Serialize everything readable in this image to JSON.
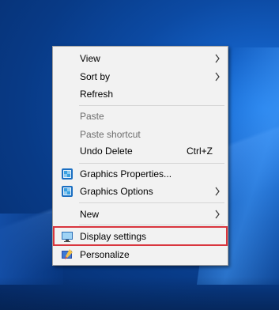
{
  "menu": {
    "items": [
      {
        "label": "View",
        "has_submenu": true,
        "enabled": true
      },
      {
        "label": "Sort by",
        "has_submenu": true,
        "enabled": true
      },
      {
        "label": "Refresh",
        "has_submenu": false,
        "enabled": true
      },
      {
        "label": "Paste",
        "has_submenu": false,
        "enabled": false
      },
      {
        "label": "Paste shortcut",
        "has_submenu": false,
        "enabled": false
      },
      {
        "label": "Undo Delete",
        "shortcut": "Ctrl+Z",
        "has_submenu": false,
        "enabled": true
      },
      {
        "label": "Graphics Properties...",
        "icon": "intel-graphics-icon",
        "has_submenu": false,
        "enabled": true
      },
      {
        "label": "Graphics Options",
        "icon": "intel-graphics-icon",
        "has_submenu": true,
        "enabled": true
      },
      {
        "label": "New",
        "has_submenu": true,
        "enabled": true
      },
      {
        "label": "Display settings",
        "icon": "display-icon",
        "has_submenu": false,
        "enabled": true,
        "highlighted": true
      },
      {
        "label": "Personalize",
        "icon": "personalize-icon",
        "has_submenu": false,
        "enabled": true
      }
    ]
  },
  "colors": {
    "menu_background": "#f2f2f2",
    "highlight_border": "#d9363e",
    "disabled_text": "#6d6d6d",
    "desktop_blue": "#0a3f8e"
  }
}
